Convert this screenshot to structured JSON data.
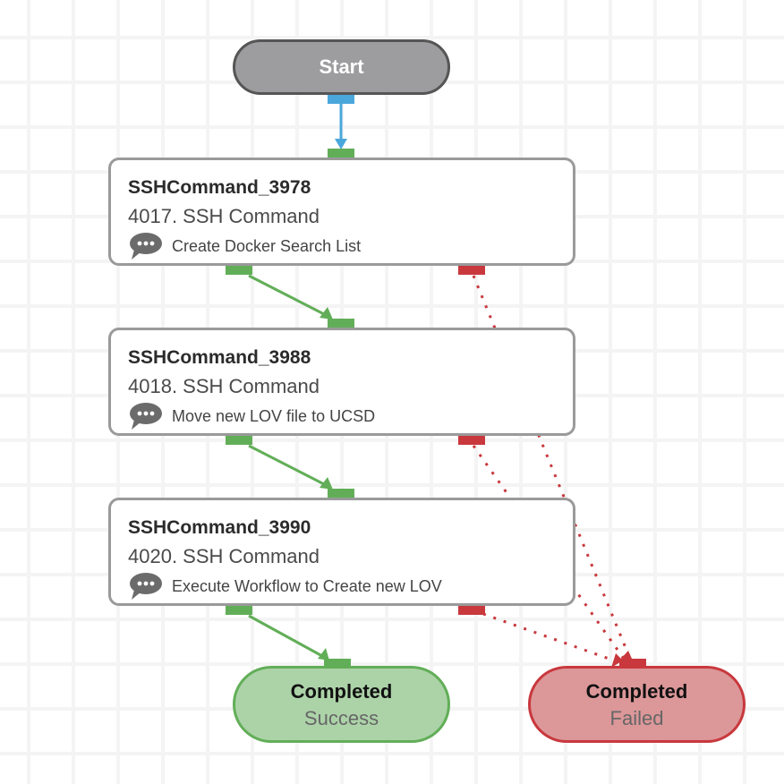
{
  "colors": {
    "success": "#62ae58",
    "failure": "#c8383d",
    "start_connector": "#4aa7dc",
    "node_border": "#9a9a9a",
    "start_fill": "#9d9d9f"
  },
  "start": {
    "label": "Start"
  },
  "nodes": [
    {
      "title": "SSHCommand_3978",
      "subtitle": "4017. SSH Command",
      "comment": "Create Docker Search List",
      "comment_icon": "speech-bubble-icon"
    },
    {
      "title": "SSHCommand_3988",
      "subtitle": "4018. SSH Command",
      "comment": "Move new LOV file to UCSD",
      "comment_icon": "speech-bubble-icon"
    },
    {
      "title": "SSHCommand_3990",
      "subtitle": "4020. SSH Command",
      "comment": "Execute Workflow to Create new LOV",
      "comment_icon": "speech-bubble-icon"
    }
  ],
  "end_success": {
    "title": "Completed",
    "status": "Success"
  },
  "end_failed": {
    "title": "Completed",
    "status": "Failed"
  },
  "connections": [
    {
      "from": "Start",
      "to": "SSHCommand_3978",
      "type": "start"
    },
    {
      "from": "SSHCommand_3978",
      "to": "SSHCommand_3988",
      "type": "success"
    },
    {
      "from": "SSHCommand_3988",
      "to": "SSHCommand_3990",
      "type": "success"
    },
    {
      "from": "SSHCommand_3990",
      "to": "Completed Success",
      "type": "success"
    },
    {
      "from": "SSHCommand_3978",
      "to": "Completed Failed",
      "type": "failure"
    },
    {
      "from": "SSHCommand_3988",
      "to": "Completed Failed",
      "type": "failure"
    },
    {
      "from": "SSHCommand_3990",
      "to": "Completed Failed",
      "type": "failure"
    }
  ]
}
